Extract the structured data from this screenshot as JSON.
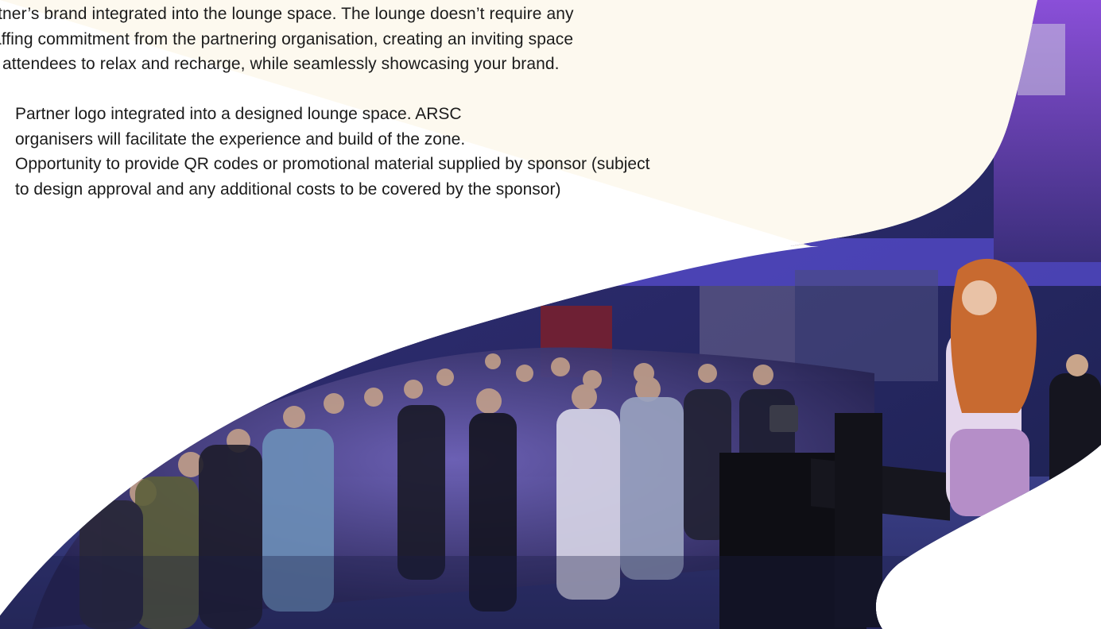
{
  "intro": {
    "lines": [
      "rtner’s brand integrated into the lounge space. The lounge doesn’t require any",
      "affing commitment from the partnering organisation, creating an inviting space",
      "r attendees to relax and recharge, while seamlessly showcasing your brand."
    ]
  },
  "benefits": [
    {
      "lines": [
        "Partner logo integrated into a designed lounge space. ARSC",
        "organisers will facilitate the experience and build of the zone."
      ]
    },
    {
      "lines": [
        "Opportunity to provide QR codes or promotional material supplied by sponsor (subject",
        "to design approval and any additional costs to be covered by the sponsor)"
      ]
    }
  ],
  "colors": {
    "cream": "#fdf9ef",
    "text": "#1b1b1b",
    "stage_purple": "#6a3fd0",
    "hall_blue": "#2e2c7a"
  }
}
